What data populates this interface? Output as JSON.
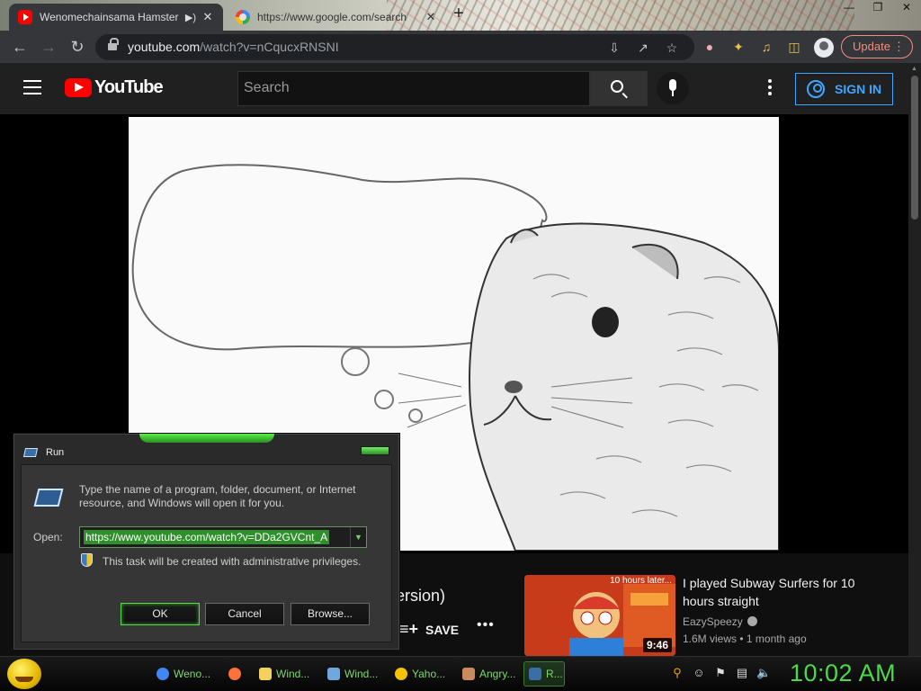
{
  "browser": {
    "tabs": [
      {
        "title": "Wenomechainsama Hamster",
        "active": true,
        "audio": true
      },
      {
        "title": "https://www.google.com/search",
        "active": false,
        "audio": false
      }
    ],
    "url_host": "youtube.com",
    "url_path": "/watch?v=nCqucxRNSNI",
    "update_label": "Update"
  },
  "youtube": {
    "logo_text": "YouTube",
    "search_placeholder": "Search",
    "sign_in_label": "SIGN IN",
    "video_title_fragment": "ersion)",
    "save_label": "SAVE",
    "recommended": {
      "badge": "10 hours later...",
      "duration": "9:46",
      "title": "I played Subway Surfers for 10 hours straight",
      "channel": "EazySpeezy",
      "views": "1.6M views",
      "age": "1 month ago"
    }
  },
  "run_dialog": {
    "title": "Run",
    "description": "Type the name of a program, folder, document, or Internet resource, and Windows will open it for you.",
    "open_label": "Open:",
    "open_value": "https://www.youtube.com/watch?v=DDa2GVCnt_A",
    "admin_note": "This task will be created with administrative privileges.",
    "ok_label": "OK",
    "cancel_label": "Cancel",
    "browse_label": "Browse..."
  },
  "taskbar": {
    "items": [
      {
        "label": "Weno...",
        "color": "#4285f4"
      },
      {
        "label": "",
        "color": "#ff7139"
      },
      {
        "label": "Wind...",
        "color": "#f2d15c"
      },
      {
        "label": "Wind...",
        "color": "#6fa8dc"
      },
      {
        "label": "Yaho...",
        "color": "#f5c400"
      },
      {
        "label": "Angry...",
        "color": "#c98b5e"
      },
      {
        "label": "R...",
        "color": "#3a6ea5"
      }
    ],
    "clock": "10:02 AM"
  },
  "colors": {
    "accent_green": "#4dd94a",
    "youtube_red": "#ff0000",
    "signin_blue": "#3ea6ff"
  }
}
